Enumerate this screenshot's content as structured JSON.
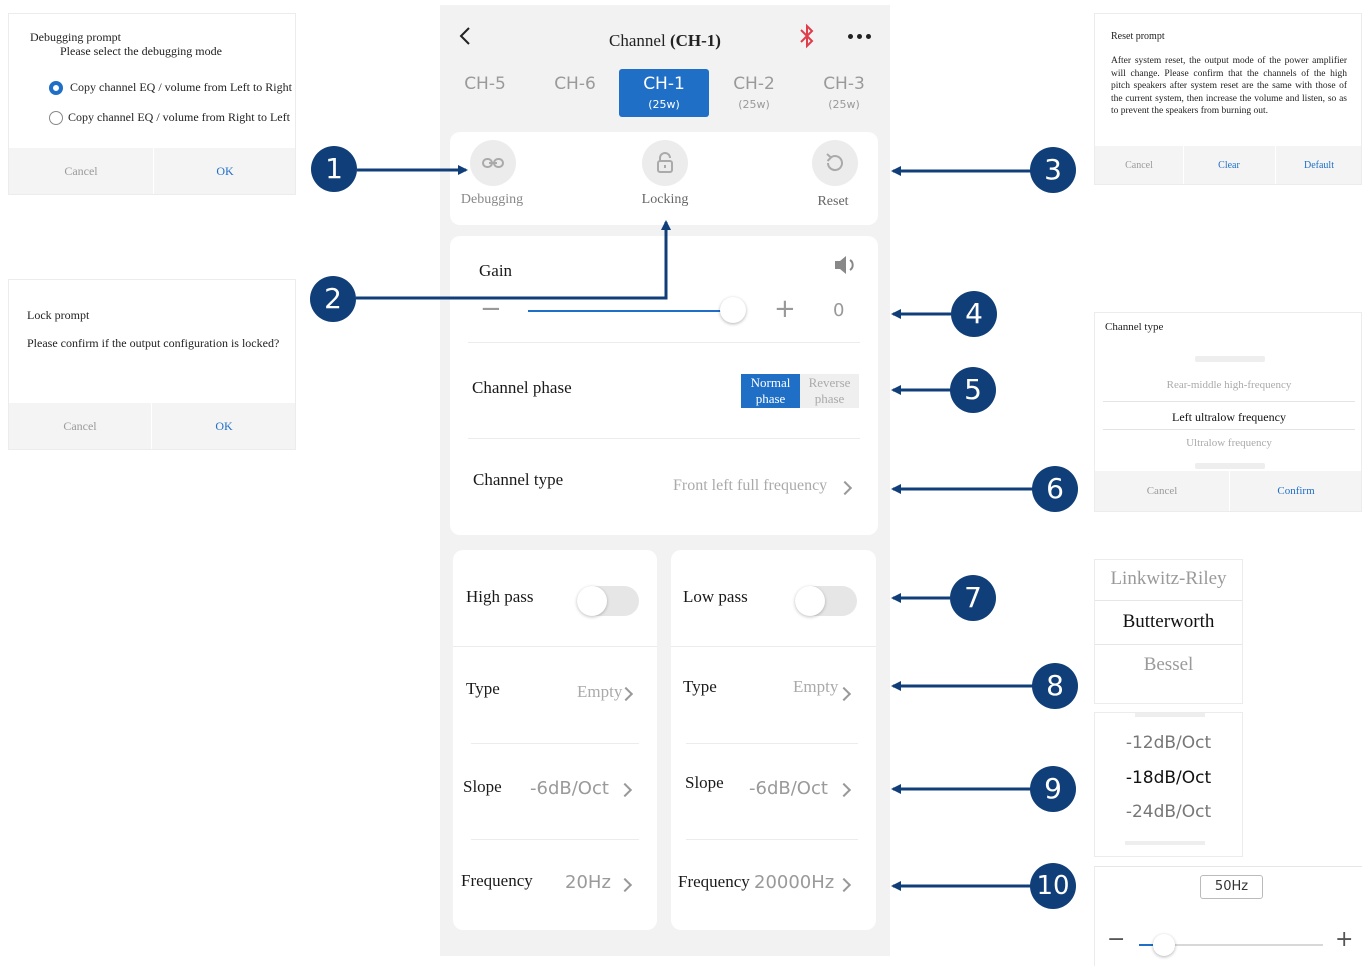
{
  "phone": {
    "title_prefix": "Channel",
    "title_channel": "(CH-1)",
    "tabs": [
      {
        "label": "CH-5",
        "sub": ""
      },
      {
        "label": "CH-6",
        "sub": ""
      },
      {
        "label": "CH-1",
        "sub": "(25w)"
      },
      {
        "label": "CH-2",
        "sub": "(25w)"
      },
      {
        "label": "CH-3",
        "sub": "(25w)"
      }
    ],
    "active_tab": "CH-1",
    "actions": {
      "debugging": "Debugging",
      "locking": "Locking",
      "reset": "Reset"
    },
    "gain": {
      "label": "Gain",
      "value": "0",
      "level_percent": 100,
      "minus": "−",
      "plus": "+"
    },
    "phase": {
      "label": "Channel phase",
      "normal": "Normal phase",
      "reverse": "Reverse phase",
      "selected": "Normal phase"
    },
    "channel_type": {
      "label": "Channel type",
      "value": "Front left full frequency"
    },
    "high_pass": {
      "label": "High pass",
      "enabled": false,
      "type_label": "Type",
      "type_value": "Empty",
      "slope_label": "Slope",
      "slope_value": "-6dB/Oct",
      "freq_label": "Frequency",
      "freq_value": "20Hz"
    },
    "low_pass": {
      "label": "Low pass",
      "enabled": false,
      "type_label": "Type",
      "type_value": "Empty",
      "slope_label": "Slope",
      "slope_value": "-6dB/Oct",
      "freq_label": "Frequency",
      "freq_value": "20000Hz"
    }
  },
  "debug_dialog": {
    "title": "Debugging prompt",
    "subtitle": "Please select the debugging mode",
    "option1": "Copy channel EQ / volume from Left to Right",
    "option2": "Copy channel EQ / volume from Right to Left",
    "selected": "option1",
    "cancel": "Cancel",
    "ok": "OK"
  },
  "lock_dialog": {
    "title": "Lock prompt",
    "message": "Please confirm if the output configuration is locked?",
    "cancel": "Cancel",
    "ok": "OK"
  },
  "reset_dialog": {
    "title": "Reset prompt",
    "message": "After system reset, the output mode of the power amplifier will change. Please confirm that the channels of the high pitch speakers after system reset are the same with those of the current system, then increase the volume and listen, so as to prevent the speakers from burning out.",
    "cancel": "Cancel",
    "clear": "Clear",
    "default": "Default"
  },
  "type_dialog": {
    "title": "Channel type",
    "options": [
      "Rear-middle high-frequency",
      "Left ultralow frequency",
      "Ultralow frequency"
    ],
    "selected": "Left ultralow frequency",
    "cancel": "Cancel",
    "confirm": "Confirm"
  },
  "filter_picker": {
    "options": [
      "Linkwitz-Riley",
      "Butterworth",
      "Bessel"
    ],
    "selected": "Butterworth"
  },
  "slope_picker": {
    "options": [
      "-12dB/Oct",
      "-18dB/Oct",
      "-24dB/Oct"
    ],
    "selected": "-18dB/Oct"
  },
  "freq_picker": {
    "value": "50Hz",
    "minus": "−",
    "plus": "+"
  },
  "callouts": [
    "1",
    "2",
    "3",
    "4",
    "5",
    "6",
    "7",
    "8",
    "9",
    "10"
  ],
  "colors": {
    "accent": "#1f6fc6",
    "callout": "#0f3e78",
    "bluetooth": "#e23b4a",
    "background": "#f2f2f2"
  }
}
